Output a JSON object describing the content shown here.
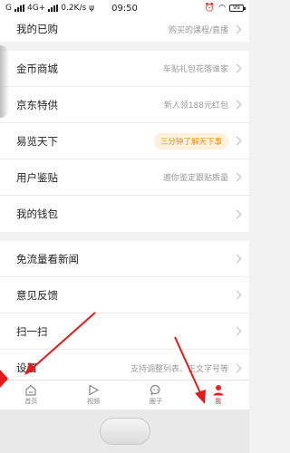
{
  "status_bar": {
    "carrier": "G",
    "network": "4G+",
    "speed": "0.2K/s",
    "time": "09:50",
    "battery": "99"
  },
  "menu": {
    "purchased": {
      "label": "我的已购",
      "desc": "购买的课程/直播"
    },
    "gold_mall": {
      "label": "金币商城",
      "desc": "车贴礼包花落谁家"
    },
    "jd_special": {
      "label": "京东特供",
      "desc": "新人领188元红包"
    },
    "yilan": {
      "label": "易览天下",
      "pill": "三分钟了解天下事"
    },
    "user_review": {
      "label": "用户鉴贴",
      "desc": "邀你鉴定跟贴质量"
    },
    "wallet": {
      "label": "我的钱包"
    },
    "free_data": {
      "label": "免流量看新闻"
    },
    "feedback": {
      "label": "意见反馈"
    },
    "scan": {
      "label": "扫一扫"
    },
    "settings": {
      "label": "设置",
      "desc": "支持调整列表、正文字号等"
    }
  },
  "tabbar": {
    "home": "首页",
    "video": "视频",
    "circle": "圈子",
    "me": "我"
  },
  "colors": {
    "accent_red": "#e42525",
    "pill_orange": "#e8930e"
  }
}
